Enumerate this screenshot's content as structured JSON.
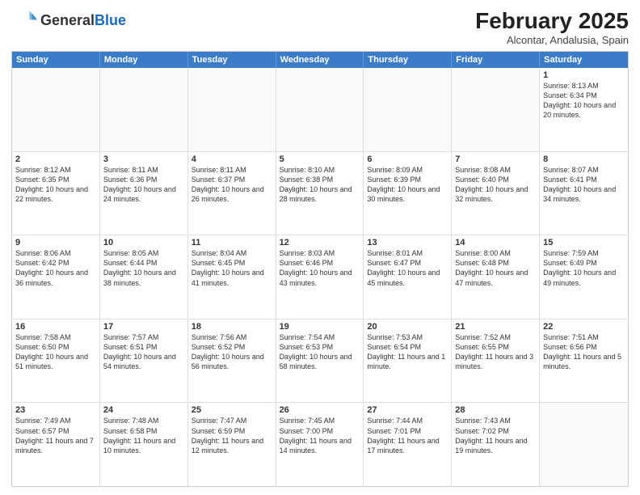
{
  "header": {
    "logo_general": "General",
    "logo_blue": "Blue",
    "title": "February 2025",
    "subtitle": "Alcontar, Andalusia, Spain"
  },
  "weekdays": [
    "Sunday",
    "Monday",
    "Tuesday",
    "Wednesday",
    "Thursday",
    "Friday",
    "Saturday"
  ],
  "weeks": [
    [
      {
        "day": "",
        "info": ""
      },
      {
        "day": "",
        "info": ""
      },
      {
        "day": "",
        "info": ""
      },
      {
        "day": "",
        "info": ""
      },
      {
        "day": "",
        "info": ""
      },
      {
        "day": "",
        "info": ""
      },
      {
        "day": "1",
        "info": "Sunrise: 8:13 AM\nSunset: 6:34 PM\nDaylight: 10 hours and 20 minutes."
      }
    ],
    [
      {
        "day": "2",
        "info": "Sunrise: 8:12 AM\nSunset: 6:35 PM\nDaylight: 10 hours and 22 minutes."
      },
      {
        "day": "3",
        "info": "Sunrise: 8:11 AM\nSunset: 6:36 PM\nDaylight: 10 hours and 24 minutes."
      },
      {
        "day": "4",
        "info": "Sunrise: 8:11 AM\nSunset: 6:37 PM\nDaylight: 10 hours and 26 minutes."
      },
      {
        "day": "5",
        "info": "Sunrise: 8:10 AM\nSunset: 6:38 PM\nDaylight: 10 hours and 28 minutes."
      },
      {
        "day": "6",
        "info": "Sunrise: 8:09 AM\nSunset: 6:39 PM\nDaylight: 10 hours and 30 minutes."
      },
      {
        "day": "7",
        "info": "Sunrise: 8:08 AM\nSunset: 6:40 PM\nDaylight: 10 hours and 32 minutes."
      },
      {
        "day": "8",
        "info": "Sunrise: 8:07 AM\nSunset: 6:41 PM\nDaylight: 10 hours and 34 minutes."
      }
    ],
    [
      {
        "day": "9",
        "info": "Sunrise: 8:06 AM\nSunset: 6:42 PM\nDaylight: 10 hours and 36 minutes."
      },
      {
        "day": "10",
        "info": "Sunrise: 8:05 AM\nSunset: 6:44 PM\nDaylight: 10 hours and 38 minutes."
      },
      {
        "day": "11",
        "info": "Sunrise: 8:04 AM\nSunset: 6:45 PM\nDaylight: 10 hours and 41 minutes."
      },
      {
        "day": "12",
        "info": "Sunrise: 8:03 AM\nSunset: 6:46 PM\nDaylight: 10 hours and 43 minutes."
      },
      {
        "day": "13",
        "info": "Sunrise: 8:01 AM\nSunset: 6:47 PM\nDaylight: 10 hours and 45 minutes."
      },
      {
        "day": "14",
        "info": "Sunrise: 8:00 AM\nSunset: 6:48 PM\nDaylight: 10 hours and 47 minutes."
      },
      {
        "day": "15",
        "info": "Sunrise: 7:59 AM\nSunset: 6:49 PM\nDaylight: 10 hours and 49 minutes."
      }
    ],
    [
      {
        "day": "16",
        "info": "Sunrise: 7:58 AM\nSunset: 6:50 PM\nDaylight: 10 hours and 51 minutes."
      },
      {
        "day": "17",
        "info": "Sunrise: 7:57 AM\nSunset: 6:51 PM\nDaylight: 10 hours and 54 minutes."
      },
      {
        "day": "18",
        "info": "Sunrise: 7:56 AM\nSunset: 6:52 PM\nDaylight: 10 hours and 56 minutes."
      },
      {
        "day": "19",
        "info": "Sunrise: 7:54 AM\nSunset: 6:53 PM\nDaylight: 10 hours and 58 minutes."
      },
      {
        "day": "20",
        "info": "Sunrise: 7:53 AM\nSunset: 6:54 PM\nDaylight: 11 hours and 1 minute."
      },
      {
        "day": "21",
        "info": "Sunrise: 7:52 AM\nSunset: 6:55 PM\nDaylight: 11 hours and 3 minutes."
      },
      {
        "day": "22",
        "info": "Sunrise: 7:51 AM\nSunset: 6:56 PM\nDaylight: 11 hours and 5 minutes."
      }
    ],
    [
      {
        "day": "23",
        "info": "Sunrise: 7:49 AM\nSunset: 6:57 PM\nDaylight: 11 hours and 7 minutes."
      },
      {
        "day": "24",
        "info": "Sunrise: 7:48 AM\nSunset: 6:58 PM\nDaylight: 11 hours and 10 minutes."
      },
      {
        "day": "25",
        "info": "Sunrise: 7:47 AM\nSunset: 6:59 PM\nDaylight: 11 hours and 12 minutes."
      },
      {
        "day": "26",
        "info": "Sunrise: 7:45 AM\nSunset: 7:00 PM\nDaylight: 11 hours and 14 minutes."
      },
      {
        "day": "27",
        "info": "Sunrise: 7:44 AM\nSunset: 7:01 PM\nDaylight: 11 hours and 17 minutes."
      },
      {
        "day": "28",
        "info": "Sunrise: 7:43 AM\nSunset: 7:02 PM\nDaylight: 11 hours and 19 minutes."
      },
      {
        "day": "",
        "info": ""
      }
    ]
  ]
}
